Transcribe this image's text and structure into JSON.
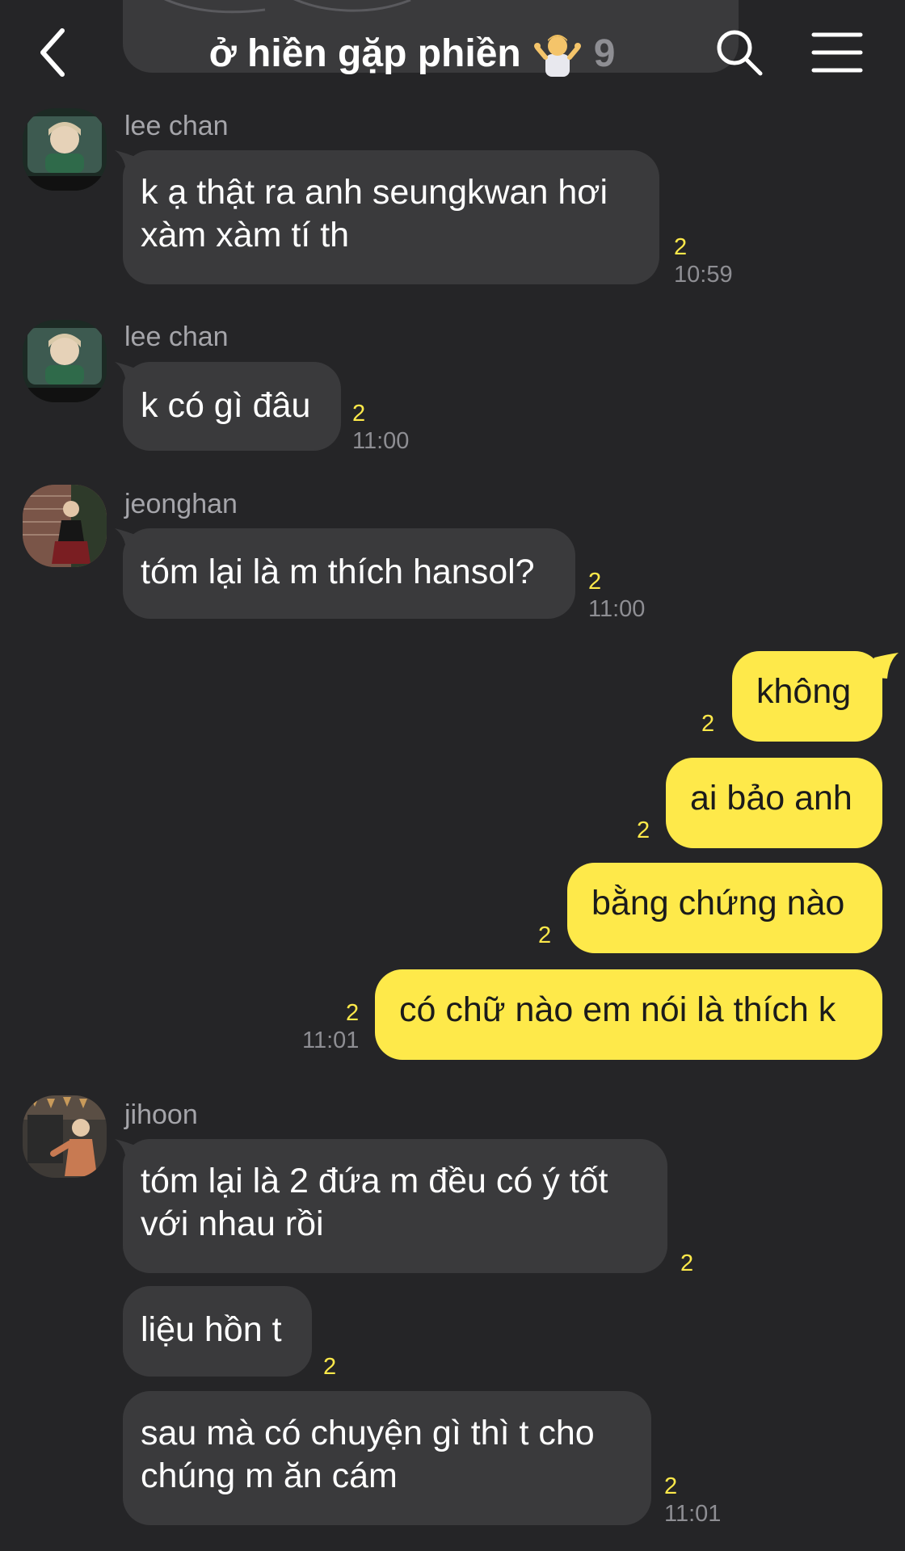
{
  "header": {
    "title": "ở hiền gặp phiền",
    "member_count": "9"
  },
  "messages": [
    {
      "sender": "lee chan",
      "text": "k ạ thật ra anh seungkwan hơi\nxàm xàm tí th",
      "unread": "2",
      "time": "10:59"
    },
    {
      "sender": "lee chan",
      "text": "k có gì đâu",
      "unread": "2",
      "time": "11:00"
    },
    {
      "sender": "jeonghan",
      "text": "tóm lại là m thích hansol?",
      "unread": "2",
      "time": "11:00"
    },
    {
      "text": "không",
      "unread": "2"
    },
    {
      "text": "ai bảo anh",
      "unread": "2"
    },
    {
      "text": "bằng chứng nào",
      "unread": "2"
    },
    {
      "text": "có chữ nào em nói là thích k",
      "unread": "2",
      "time": "11:01"
    },
    {
      "sender": "jihoon",
      "text": "tóm lại là 2 đứa m đều có ý tốt\nvới nhau rồi",
      "unread": "2"
    },
    {
      "text": "liệu hồn t",
      "unread": "2"
    },
    {
      "text": "sau mà có chuyện gì thì t cho\nchúng m ăn cám",
      "unread": "2",
      "time": "11:01"
    }
  ],
  "colors": {
    "background": "#252527",
    "incoming_bubble": "#3a3a3c",
    "outgoing_bubble": "#fee94a",
    "unread": "#fee94a",
    "meta_text": "#8e8e93"
  },
  "icons": {
    "back": "chevron-left-icon",
    "title_emoji": "person-shrugging-emoji",
    "search": "search-icon",
    "menu": "hamburger-menu-icon"
  }
}
